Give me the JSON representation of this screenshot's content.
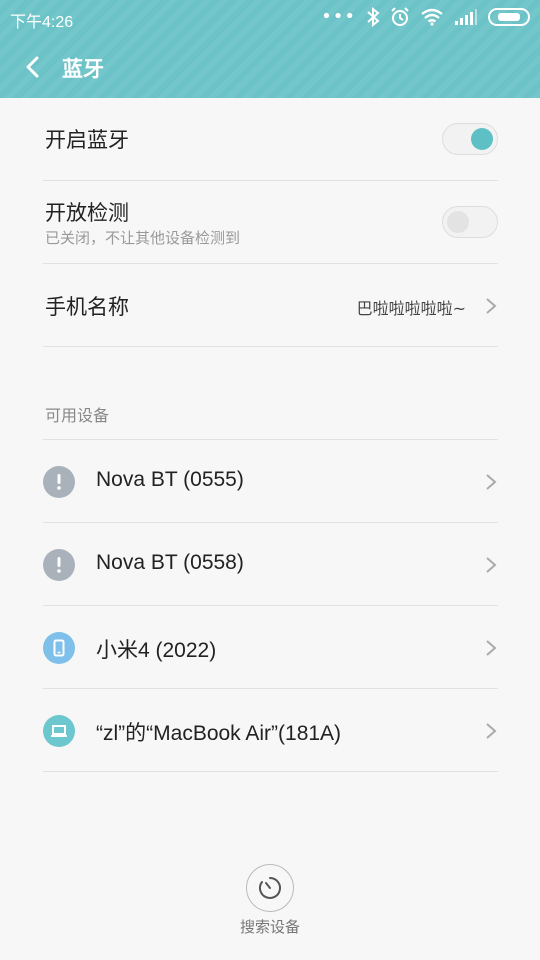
{
  "status_bar": {
    "time": "下午4:26",
    "icons": [
      "more-dots-icon",
      "bluetooth-icon",
      "alarm-icon",
      "wifi-icon",
      "signal-icon",
      "battery-icon"
    ]
  },
  "header": {
    "title": "蓝牙",
    "back_icon": "back-arrow-icon",
    "color": "#6cc3c7"
  },
  "settings": {
    "bluetooth_toggle": {
      "label": "开启蓝牙",
      "state": "on"
    },
    "discoverable_toggle": {
      "label": "开放检测",
      "subtitle": "已关闭，不让其他设备检测到",
      "state": "off"
    },
    "device_name": {
      "label": "手机名称",
      "value": "巴啦啦啦啦啦~"
    }
  },
  "available_devices": {
    "section_label": "可用设备",
    "items": [
      {
        "name": "Nova BT (0555)",
        "icon": "exclamation-icon",
        "icon_color": "#a9b2bb"
      },
      {
        "name": "Nova BT (0558)",
        "icon": "exclamation-icon",
        "icon_color": "#a9b2bb"
      },
      {
        "name": "小米4 (2022)",
        "icon": "phone-icon",
        "icon_color": "#7fc0ea"
      },
      {
        "name": "“zl”的“MacBook Air”(181A)",
        "icon": "laptop-icon",
        "icon_color": "#6cc7cf"
      }
    ]
  },
  "footer": {
    "search_label": "搜索设备",
    "search_icon": "refresh-search-icon"
  },
  "accent_color": "#5ec0c5"
}
